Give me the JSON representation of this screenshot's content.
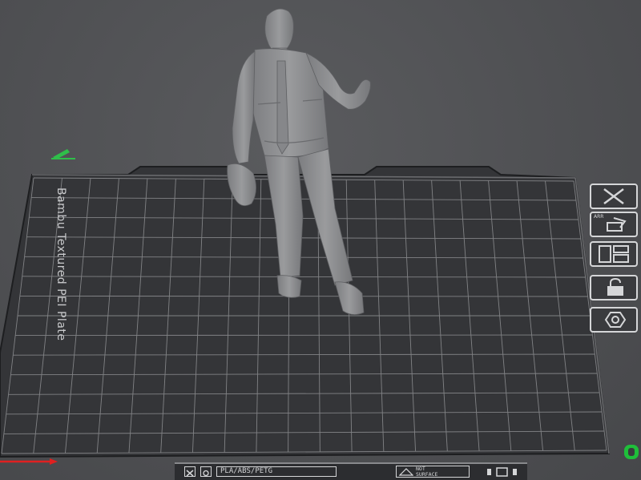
{
  "viewport": {
    "plate_name": "Bambu Textured PEI Plate"
  },
  "colors": {
    "background": "#505154",
    "plate_surface": "#3a3b3e",
    "grid_line": "#8a8b8e",
    "model": "#8e8f91",
    "axis_x": "#e02020",
    "gizmo": "#2fbf4a",
    "badge": "#1fbf3a"
  },
  "right_toolbar": {
    "items": [
      {
        "name": "close",
        "icon": "close-x-icon"
      },
      {
        "name": "auto-arrange",
        "icon": "auto-arrange-icon",
        "caption": "ARR"
      },
      {
        "name": "arrange-layout",
        "icon": "layout-grid-icon"
      },
      {
        "name": "lock",
        "icon": "lock-icon"
      },
      {
        "name": "settings",
        "icon": "hexagon-eye-icon"
      }
    ]
  },
  "plate_status_bar": {
    "filament_types": "PLA/ABS/PETG",
    "warning_text": "NOT\nSURFACE"
  }
}
